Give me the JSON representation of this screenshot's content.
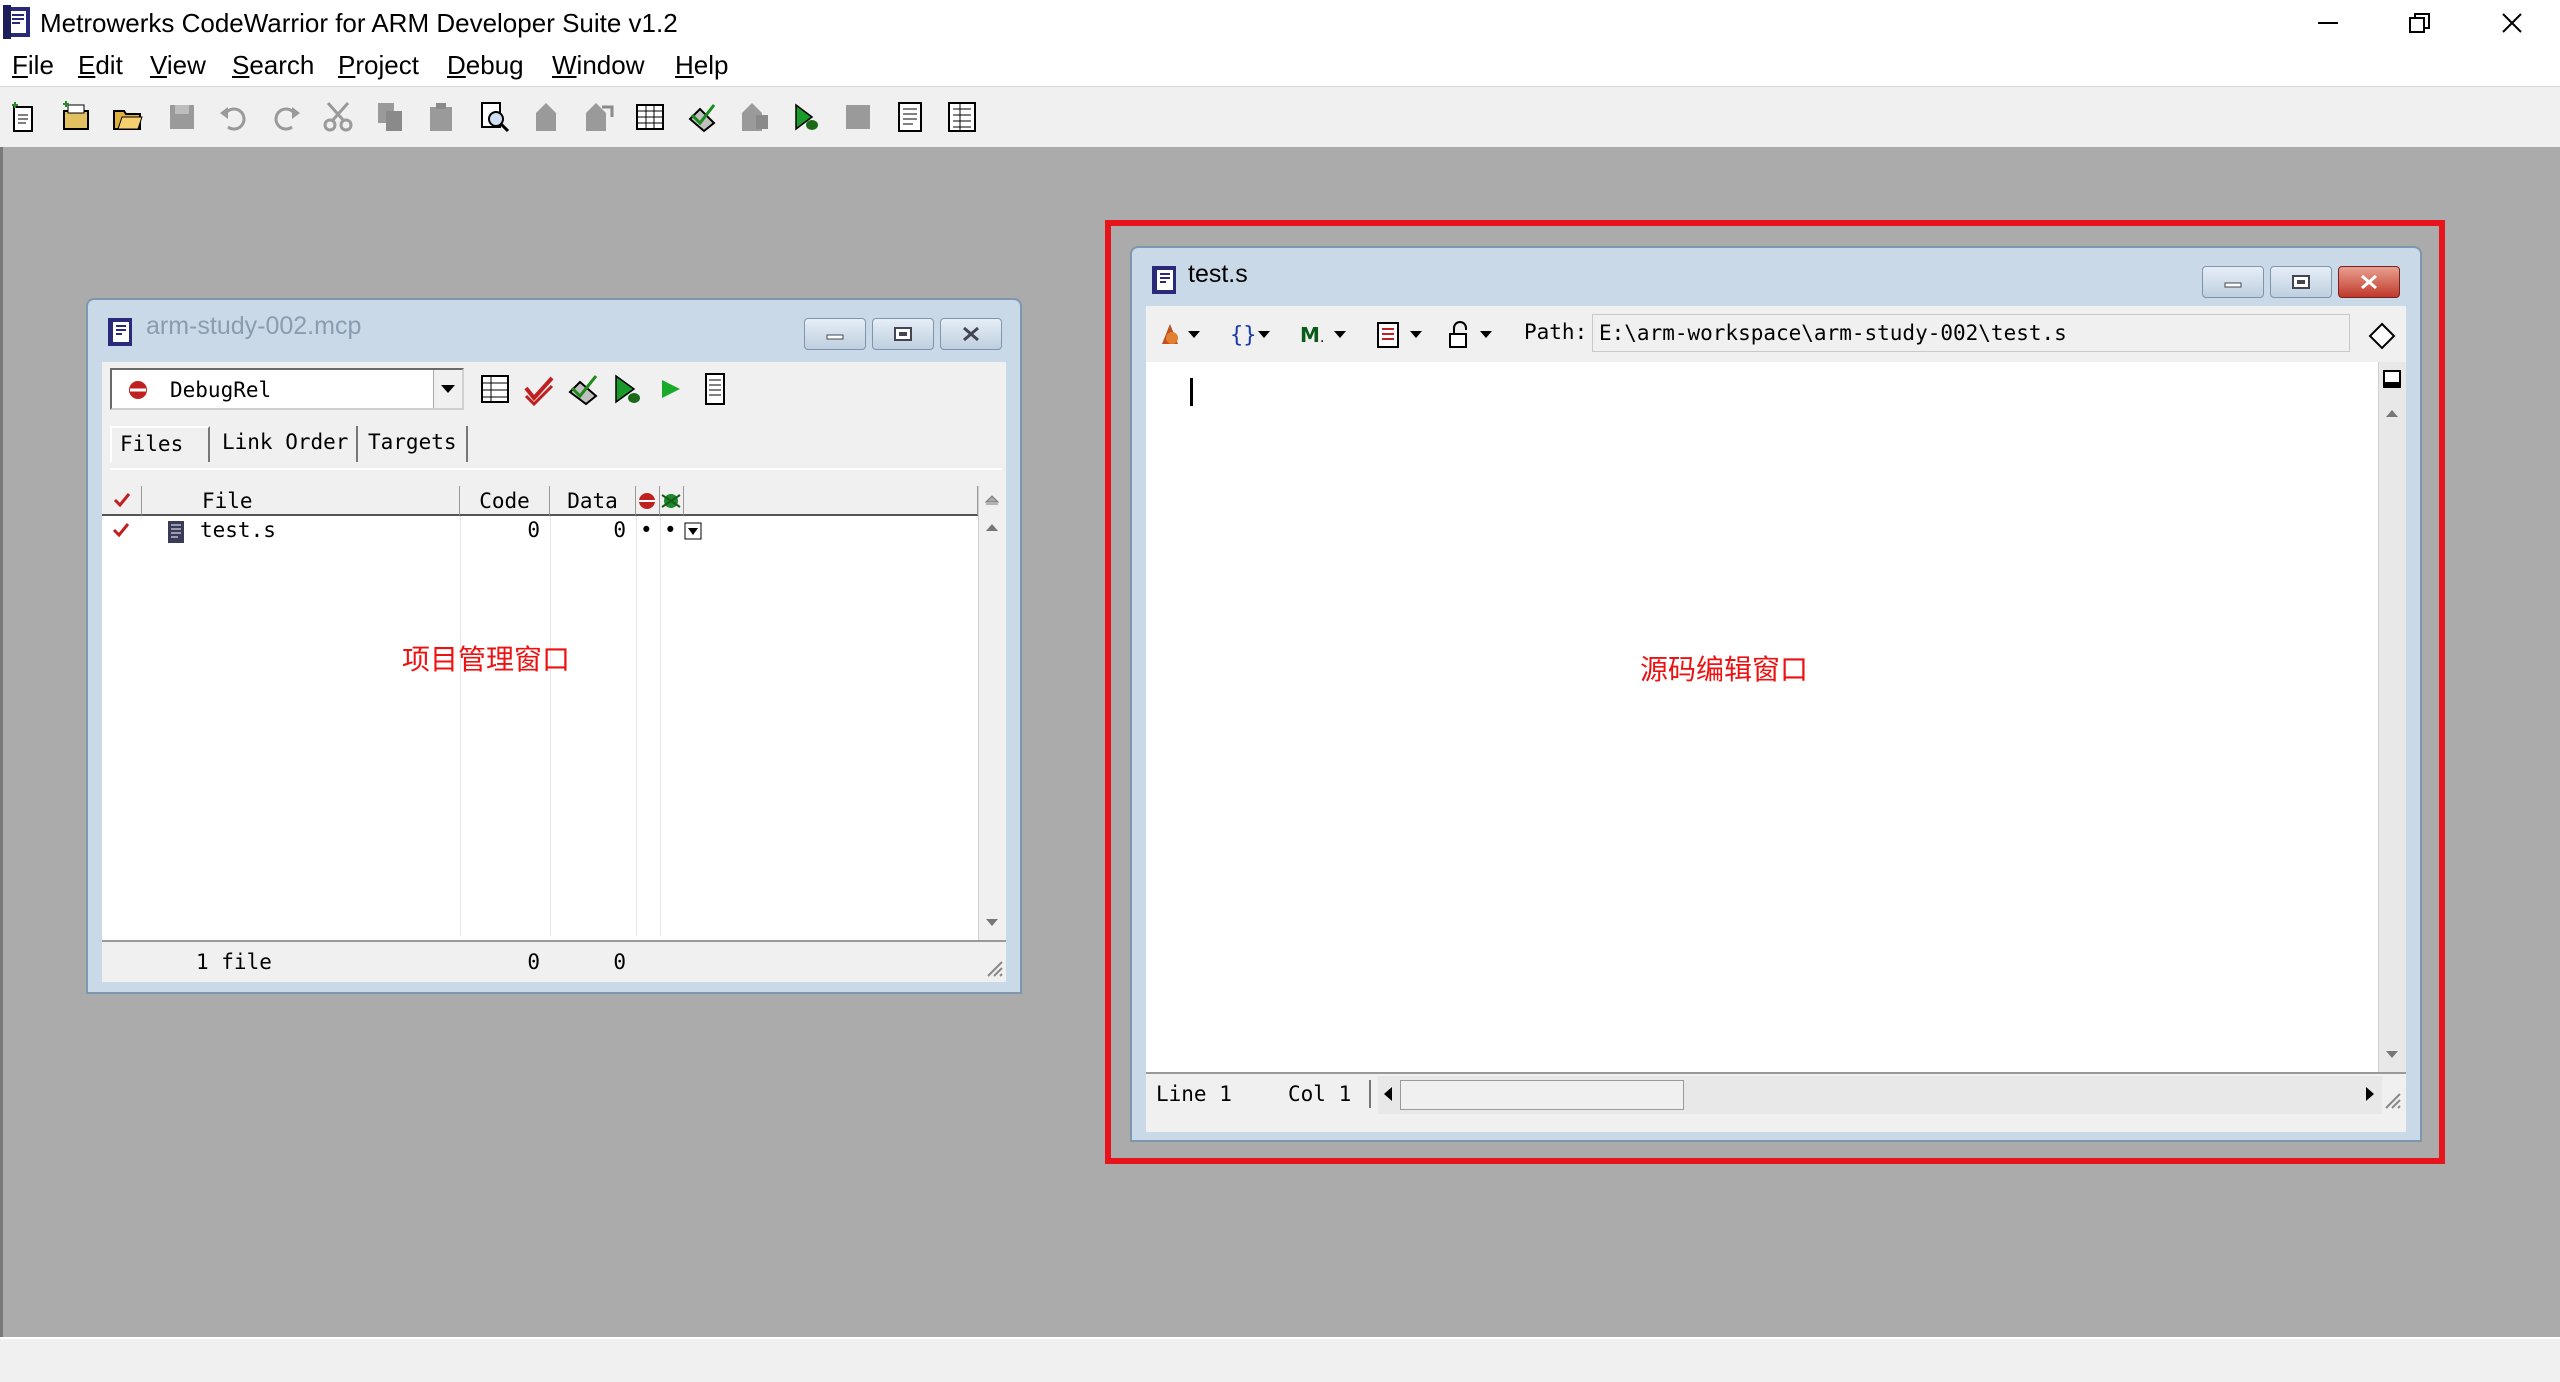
{
  "app": {
    "title": "Metrowerks CodeWarrior for ARM Developer Suite v1.2",
    "window_buttons": [
      "minimize",
      "restore",
      "close"
    ]
  },
  "menu": [
    {
      "label": "File",
      "accel": "F",
      "rest": "ile"
    },
    {
      "label": "Edit",
      "accel": "E",
      "rest": "dit"
    },
    {
      "label": "View",
      "accel": "V",
      "rest": "iew"
    },
    {
      "label": "Search",
      "accel": "S",
      "rest": "earch"
    },
    {
      "label": "Project",
      "accel": "P",
      "rest": "roject"
    },
    {
      "label": "Debug",
      "accel": "D",
      "rest": "ebug"
    },
    {
      "label": "Window",
      "accel": "W",
      "rest": "indow"
    },
    {
      "label": "Help",
      "accel": "H",
      "rest": "elp"
    }
  ],
  "toolbar_icons": [
    "new-text-file-icon",
    "new-project-icon",
    "open-icon",
    "save-icon",
    "undo-icon",
    "redo-icon",
    "cut-icon",
    "copy-icon",
    "paste-icon",
    "find-icon",
    "find-next-icon",
    "replace-icon",
    "project-settings-icon",
    "make-icon",
    "compile-icon",
    "debug-icon",
    "run-icon",
    "stop-icon",
    "properties-icon",
    "class-browser-icon"
  ],
  "project_window": {
    "title": "arm-study-002.mcp",
    "target": "DebugRel",
    "tabs": [
      "Files",
      "Link Order",
      "Targets"
    ],
    "columns": {
      "file": "File",
      "code": "Code",
      "data": "Data"
    },
    "rows": [
      {
        "name": "test.s",
        "code": "0",
        "data": "0",
        "debug": "•",
        "target": "•"
      }
    ],
    "footer": {
      "count": "1 file",
      "code": "0",
      "data": "0"
    },
    "annotation": "项目管理窗口"
  },
  "editor_window": {
    "title": "test.s",
    "path_label": "Path:",
    "path": "E:\\arm-workspace\\arm-study-002\\test.s",
    "line": "Line 1",
    "col": "Col 1",
    "annotation": "源码编辑窗口",
    "highlight_color": "#e8141c"
  },
  "colors": {
    "mdi_background": "#ababab",
    "child_frame": "#c9d9e8",
    "annotation": "#ee1111"
  }
}
